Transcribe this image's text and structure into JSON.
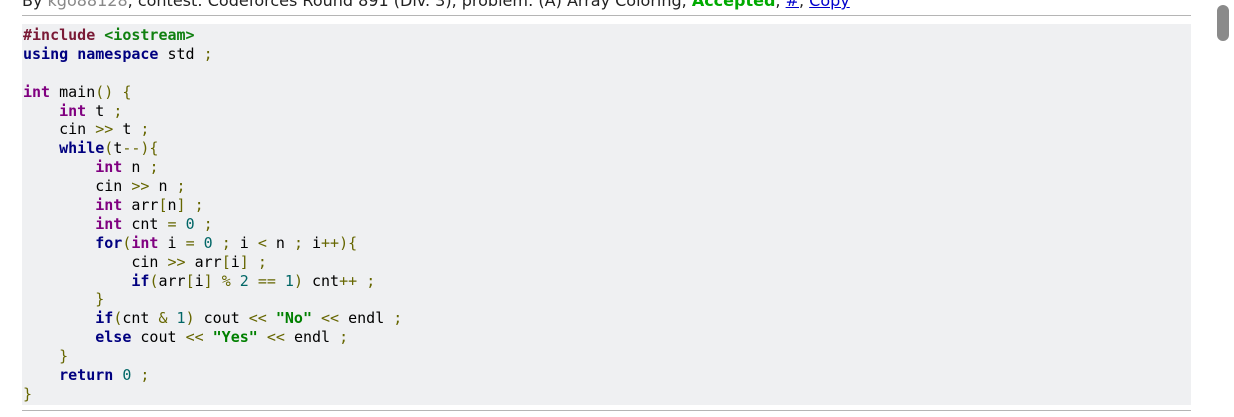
{
  "header": {
    "prefix": "By ",
    "author": "kgo88128",
    "middle": ", contest: Codeforces Round 891 (Div. 3), problem: (A) Array Coloring, ",
    "verdict": "Accepted",
    "sep1": ", ",
    "hash_link": "#",
    "sep2": ", ",
    "copy_link": "Copy"
  },
  "code": {
    "lines": [
      [
        {
          "t": "pp",
          "v": "#include "
        },
        {
          "t": "inc",
          "v": "<iostream>"
        }
      ],
      [
        {
          "t": "kw",
          "v": "using"
        },
        {
          "t": "sp",
          "v": " "
        },
        {
          "t": "kw",
          "v": "namespace"
        },
        {
          "t": "sp",
          "v": " "
        },
        {
          "t": "id",
          "v": "std"
        },
        {
          "t": "sp",
          "v": " "
        },
        {
          "t": "pun",
          "v": ";"
        }
      ],
      [],
      [
        {
          "t": "type",
          "v": "int"
        },
        {
          "t": "sp",
          "v": " "
        },
        {
          "t": "id",
          "v": "main"
        },
        {
          "t": "pun",
          "v": "()"
        },
        {
          "t": "sp",
          "v": " "
        },
        {
          "t": "pun",
          "v": "{"
        }
      ],
      [
        {
          "t": "sp",
          "v": "    "
        },
        {
          "t": "type",
          "v": "int"
        },
        {
          "t": "sp",
          "v": " "
        },
        {
          "t": "id",
          "v": "t"
        },
        {
          "t": "sp",
          "v": " "
        },
        {
          "t": "pun",
          "v": ";"
        }
      ],
      [
        {
          "t": "sp",
          "v": "    "
        },
        {
          "t": "id",
          "v": "cin"
        },
        {
          "t": "sp",
          "v": " "
        },
        {
          "t": "pun",
          "v": ">>"
        },
        {
          "t": "sp",
          "v": " "
        },
        {
          "t": "id",
          "v": "t"
        },
        {
          "t": "sp",
          "v": " "
        },
        {
          "t": "pun",
          "v": ";"
        }
      ],
      [
        {
          "t": "sp",
          "v": "    "
        },
        {
          "t": "kw",
          "v": "while"
        },
        {
          "t": "pun",
          "v": "("
        },
        {
          "t": "id",
          "v": "t"
        },
        {
          "t": "pun",
          "v": "--){"
        }
      ],
      [
        {
          "t": "sp",
          "v": "        "
        },
        {
          "t": "type",
          "v": "int"
        },
        {
          "t": "sp",
          "v": " "
        },
        {
          "t": "id",
          "v": "n"
        },
        {
          "t": "sp",
          "v": " "
        },
        {
          "t": "pun",
          "v": ";"
        }
      ],
      [
        {
          "t": "sp",
          "v": "        "
        },
        {
          "t": "id",
          "v": "cin"
        },
        {
          "t": "sp",
          "v": " "
        },
        {
          "t": "pun",
          "v": ">>"
        },
        {
          "t": "sp",
          "v": " "
        },
        {
          "t": "id",
          "v": "n"
        },
        {
          "t": "sp",
          "v": " "
        },
        {
          "t": "pun",
          "v": ";"
        }
      ],
      [
        {
          "t": "sp",
          "v": "        "
        },
        {
          "t": "type",
          "v": "int"
        },
        {
          "t": "sp",
          "v": " "
        },
        {
          "t": "id",
          "v": "arr"
        },
        {
          "t": "pun",
          "v": "["
        },
        {
          "t": "id",
          "v": "n"
        },
        {
          "t": "pun",
          "v": "]"
        },
        {
          "t": "sp",
          "v": " "
        },
        {
          "t": "pun",
          "v": ";"
        }
      ],
      [
        {
          "t": "sp",
          "v": "        "
        },
        {
          "t": "type",
          "v": "int"
        },
        {
          "t": "sp",
          "v": " "
        },
        {
          "t": "id",
          "v": "cnt"
        },
        {
          "t": "sp",
          "v": " "
        },
        {
          "t": "pun",
          "v": "="
        },
        {
          "t": "sp",
          "v": " "
        },
        {
          "t": "num",
          "v": "0"
        },
        {
          "t": "sp",
          "v": " "
        },
        {
          "t": "pun",
          "v": ";"
        }
      ],
      [
        {
          "t": "sp",
          "v": "        "
        },
        {
          "t": "kw",
          "v": "for"
        },
        {
          "t": "pun",
          "v": "("
        },
        {
          "t": "type",
          "v": "int"
        },
        {
          "t": "sp",
          "v": " "
        },
        {
          "t": "id",
          "v": "i"
        },
        {
          "t": "sp",
          "v": " "
        },
        {
          "t": "pun",
          "v": "="
        },
        {
          "t": "sp",
          "v": " "
        },
        {
          "t": "num",
          "v": "0"
        },
        {
          "t": "sp",
          "v": " "
        },
        {
          "t": "pun",
          "v": ";"
        },
        {
          "t": "sp",
          "v": " "
        },
        {
          "t": "id",
          "v": "i"
        },
        {
          "t": "sp",
          "v": " "
        },
        {
          "t": "pun",
          "v": "<"
        },
        {
          "t": "sp",
          "v": " "
        },
        {
          "t": "id",
          "v": "n"
        },
        {
          "t": "sp",
          "v": " "
        },
        {
          "t": "pun",
          "v": ";"
        },
        {
          "t": "sp",
          "v": " "
        },
        {
          "t": "id",
          "v": "i"
        },
        {
          "t": "pun",
          "v": "++){"
        }
      ],
      [
        {
          "t": "sp",
          "v": "            "
        },
        {
          "t": "id",
          "v": "cin"
        },
        {
          "t": "sp",
          "v": " "
        },
        {
          "t": "pun",
          "v": ">>"
        },
        {
          "t": "sp",
          "v": " "
        },
        {
          "t": "id",
          "v": "arr"
        },
        {
          "t": "pun",
          "v": "["
        },
        {
          "t": "id",
          "v": "i"
        },
        {
          "t": "pun",
          "v": "]"
        },
        {
          "t": "sp",
          "v": " "
        },
        {
          "t": "pun",
          "v": ";"
        }
      ],
      [
        {
          "t": "sp",
          "v": "            "
        },
        {
          "t": "kw",
          "v": "if"
        },
        {
          "t": "pun",
          "v": "("
        },
        {
          "t": "id",
          "v": "arr"
        },
        {
          "t": "pun",
          "v": "["
        },
        {
          "t": "id",
          "v": "i"
        },
        {
          "t": "pun",
          "v": "]"
        },
        {
          "t": "sp",
          "v": " "
        },
        {
          "t": "pun",
          "v": "%"
        },
        {
          "t": "sp",
          "v": " "
        },
        {
          "t": "num",
          "v": "2"
        },
        {
          "t": "sp",
          "v": " "
        },
        {
          "t": "pun",
          "v": "=="
        },
        {
          "t": "sp",
          "v": " "
        },
        {
          "t": "num",
          "v": "1"
        },
        {
          "t": "pun",
          "v": ")"
        },
        {
          "t": "sp",
          "v": " "
        },
        {
          "t": "id",
          "v": "cnt"
        },
        {
          "t": "pun",
          "v": "++"
        },
        {
          "t": "sp",
          "v": " "
        },
        {
          "t": "pun",
          "v": ";"
        }
      ],
      [
        {
          "t": "sp",
          "v": "        "
        },
        {
          "t": "pun",
          "v": "}"
        }
      ],
      [
        {
          "t": "sp",
          "v": "        "
        },
        {
          "t": "kw",
          "v": "if"
        },
        {
          "t": "pun",
          "v": "("
        },
        {
          "t": "id",
          "v": "cnt"
        },
        {
          "t": "sp",
          "v": " "
        },
        {
          "t": "pun",
          "v": "&"
        },
        {
          "t": "sp",
          "v": " "
        },
        {
          "t": "num",
          "v": "1"
        },
        {
          "t": "pun",
          "v": ")"
        },
        {
          "t": "sp",
          "v": " "
        },
        {
          "t": "id",
          "v": "cout"
        },
        {
          "t": "sp",
          "v": " "
        },
        {
          "t": "pun",
          "v": "<<"
        },
        {
          "t": "sp",
          "v": " "
        },
        {
          "t": "str",
          "v": "\"No\""
        },
        {
          "t": "sp",
          "v": " "
        },
        {
          "t": "pun",
          "v": "<<"
        },
        {
          "t": "sp",
          "v": " "
        },
        {
          "t": "id",
          "v": "endl"
        },
        {
          "t": "sp",
          "v": " "
        },
        {
          "t": "pun",
          "v": ";"
        }
      ],
      [
        {
          "t": "sp",
          "v": "        "
        },
        {
          "t": "kw",
          "v": "else"
        },
        {
          "t": "sp",
          "v": " "
        },
        {
          "t": "id",
          "v": "cout"
        },
        {
          "t": "sp",
          "v": " "
        },
        {
          "t": "pun",
          "v": "<<"
        },
        {
          "t": "sp",
          "v": " "
        },
        {
          "t": "str",
          "v": "\"Yes\""
        },
        {
          "t": "sp",
          "v": " "
        },
        {
          "t": "pun",
          "v": "<<"
        },
        {
          "t": "sp",
          "v": " "
        },
        {
          "t": "id",
          "v": "endl"
        },
        {
          "t": "sp",
          "v": " "
        },
        {
          "t": "pun",
          "v": ";"
        }
      ],
      [
        {
          "t": "sp",
          "v": "    "
        },
        {
          "t": "pun",
          "v": "}"
        }
      ],
      [
        {
          "t": "sp",
          "v": "    "
        },
        {
          "t": "kw",
          "v": "return"
        },
        {
          "t": "sp",
          "v": " "
        },
        {
          "t": "num",
          "v": "0"
        },
        {
          "t": "sp",
          "v": " "
        },
        {
          "t": "pun",
          "v": ";"
        }
      ],
      [
        {
          "t": "pun",
          "v": "}"
        }
      ]
    ]
  }
}
